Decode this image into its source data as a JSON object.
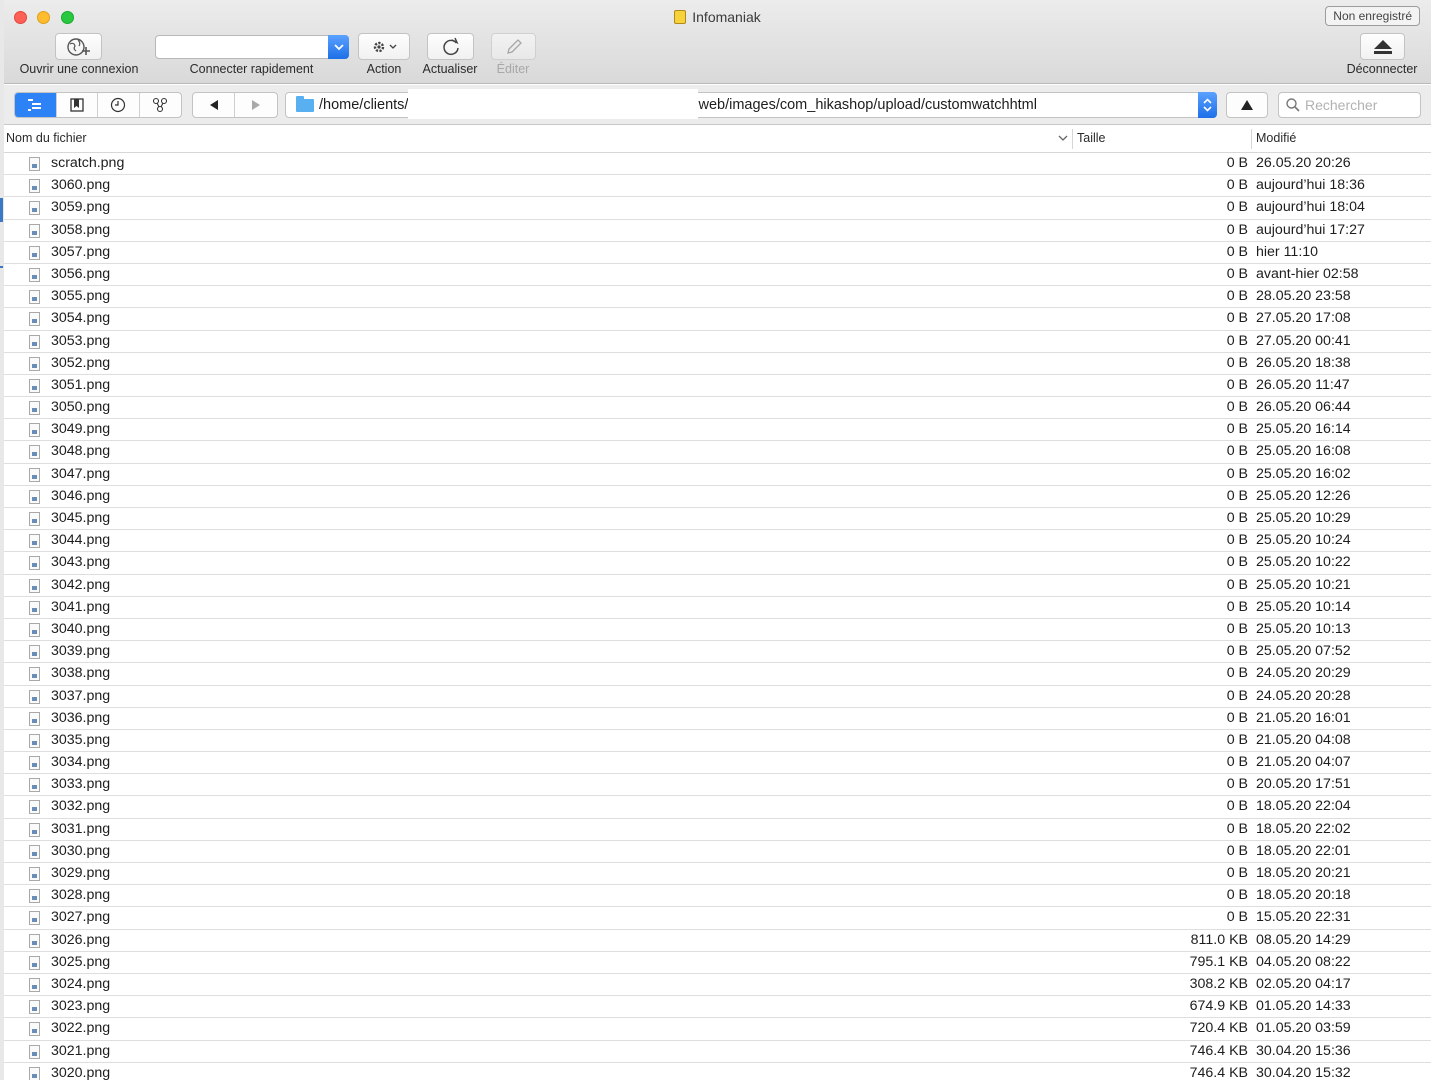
{
  "window": {
    "title": "Infomaniak",
    "registration_badge": "Non enregistré"
  },
  "toolbar": {
    "open_connection": "Ouvrir une connexion",
    "quick_connect": "Connecter rapidement",
    "quick_connect_value": "",
    "action": "Action",
    "refresh": "Actualiser",
    "edit": "Éditer",
    "disconnect": "Déconnecter"
  },
  "pathbar": {
    "path_start": "/home/clients/",
    "path_end": "web/images/com_hikashop/upload/customwatchhtml",
    "search_placeholder": "Rechercher"
  },
  "columns": {
    "name": "Nom du fichier",
    "size": "Taille",
    "modified": "Modifié"
  },
  "files": [
    {
      "name": "scratch.png",
      "size": "0 B",
      "modified": "26.05.20 20:26"
    },
    {
      "name": "3060.png",
      "size": "0 B",
      "modified": "aujourd’hui 18:36"
    },
    {
      "name": "3059.png",
      "size": "0 B",
      "modified": "aujourd’hui 18:04"
    },
    {
      "name": "3058.png",
      "size": "0 B",
      "modified": "aujourd’hui 17:27"
    },
    {
      "name": "3057.png",
      "size": "0 B",
      "modified": "hier 11:10"
    },
    {
      "name": "3056.png",
      "size": "0 B",
      "modified": "avant-hier 02:58"
    },
    {
      "name": "3055.png",
      "size": "0 B",
      "modified": "28.05.20 23:58"
    },
    {
      "name": "3054.png",
      "size": "0 B",
      "modified": "27.05.20 17:08"
    },
    {
      "name": "3053.png",
      "size": "0 B",
      "modified": "27.05.20 00:41"
    },
    {
      "name": "3052.png",
      "size": "0 B",
      "modified": "26.05.20 18:38"
    },
    {
      "name": "3051.png",
      "size": "0 B",
      "modified": "26.05.20 11:47"
    },
    {
      "name": "3050.png",
      "size": "0 B",
      "modified": "26.05.20 06:44"
    },
    {
      "name": "3049.png",
      "size": "0 B",
      "modified": "25.05.20 16:14"
    },
    {
      "name": "3048.png",
      "size": "0 B",
      "modified": "25.05.20 16:08"
    },
    {
      "name": "3047.png",
      "size": "0 B",
      "modified": "25.05.20 16:02"
    },
    {
      "name": "3046.png",
      "size": "0 B",
      "modified": "25.05.20 12:26"
    },
    {
      "name": "3045.png",
      "size": "0 B",
      "modified": "25.05.20 10:29"
    },
    {
      "name": "3044.png",
      "size": "0 B",
      "modified": "25.05.20 10:24"
    },
    {
      "name": "3043.png",
      "size": "0 B",
      "modified": "25.05.20 10:22"
    },
    {
      "name": "3042.png",
      "size": "0 B",
      "modified": "25.05.20 10:21"
    },
    {
      "name": "3041.png",
      "size": "0 B",
      "modified": "25.05.20 10:14"
    },
    {
      "name": "3040.png",
      "size": "0 B",
      "modified": "25.05.20 10:13"
    },
    {
      "name": "3039.png",
      "size": "0 B",
      "modified": "25.05.20 07:52"
    },
    {
      "name": "3038.png",
      "size": "0 B",
      "modified": "24.05.20 20:29"
    },
    {
      "name": "3037.png",
      "size": "0 B",
      "modified": "24.05.20 20:28"
    },
    {
      "name": "3036.png",
      "size": "0 B",
      "modified": "21.05.20 16:01"
    },
    {
      "name": "3035.png",
      "size": "0 B",
      "modified": "21.05.20 04:08"
    },
    {
      "name": "3034.png",
      "size": "0 B",
      "modified": "21.05.20 04:07"
    },
    {
      "name": "3033.png",
      "size": "0 B",
      "modified": "20.05.20 17:51"
    },
    {
      "name": "3032.png",
      "size": "0 B",
      "modified": "18.05.20 22:04"
    },
    {
      "name": "3031.png",
      "size": "0 B",
      "modified": "18.05.20 22:02"
    },
    {
      "name": "3030.png",
      "size": "0 B",
      "modified": "18.05.20 22:01"
    },
    {
      "name": "3029.png",
      "size": "0 B",
      "modified": "18.05.20 20:21"
    },
    {
      "name": "3028.png",
      "size": "0 B",
      "modified": "18.05.20 20:18"
    },
    {
      "name": "3027.png",
      "size": "0 B",
      "modified": "15.05.20 22:31"
    },
    {
      "name": "3026.png",
      "size": "811.0 KB",
      "modified": "08.05.20 14:29"
    },
    {
      "name": "3025.png",
      "size": "795.1 KB",
      "modified": "04.05.20 08:22"
    },
    {
      "name": "3024.png",
      "size": "308.2 KB",
      "modified": "02.05.20 04:17"
    },
    {
      "name": "3023.png",
      "size": "674.9 KB",
      "modified": "01.05.20 14:33"
    },
    {
      "name": "3022.png",
      "size": "720.4 KB",
      "modified": "01.05.20 03:59"
    },
    {
      "name": "3021.png",
      "size": "746.4 KB",
      "modified": "30.04.20 15:36"
    },
    {
      "name": "3020.png",
      "size": "746.4 KB",
      "modified": "30.04.20 15:32"
    }
  ]
}
